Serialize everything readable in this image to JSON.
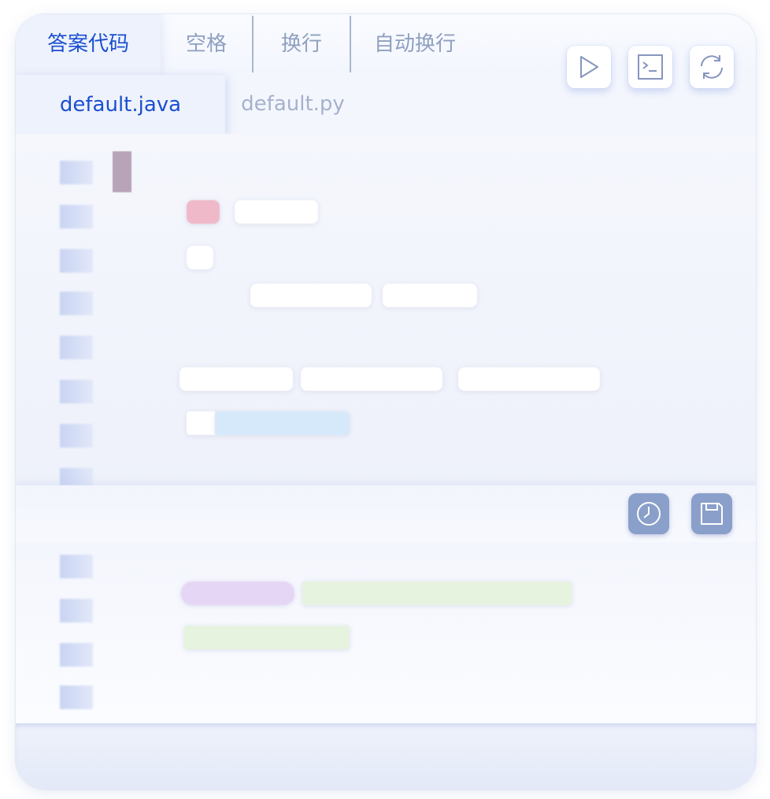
{
  "tabs": [
    {
      "label": "答案代码",
      "active": true
    },
    {
      "label": "空格",
      "active": false
    },
    {
      "label": "换行",
      "active": false
    },
    {
      "label": "自动换行",
      "active": false
    }
  ],
  "file_tabs": [
    {
      "label": "default.java",
      "active": true
    },
    {
      "label": "default.py",
      "active": false
    }
  ],
  "toolbar": {
    "run_icon": "play-icon",
    "terminal_icon": "terminal-icon",
    "refresh_icon": "refresh-icon",
    "history_icon": "clock-icon",
    "save_icon": "save-icon"
  },
  "colors": {
    "accent": "#1a4fd1",
    "inactive_text": "#8fa0bf",
    "dark_button": "#8a9fc9",
    "keyword_red": "#efb9c9",
    "string_blue": "#d6e9fb",
    "purple_token": "#e6d6f6",
    "green_token": "#e5f3df"
  }
}
